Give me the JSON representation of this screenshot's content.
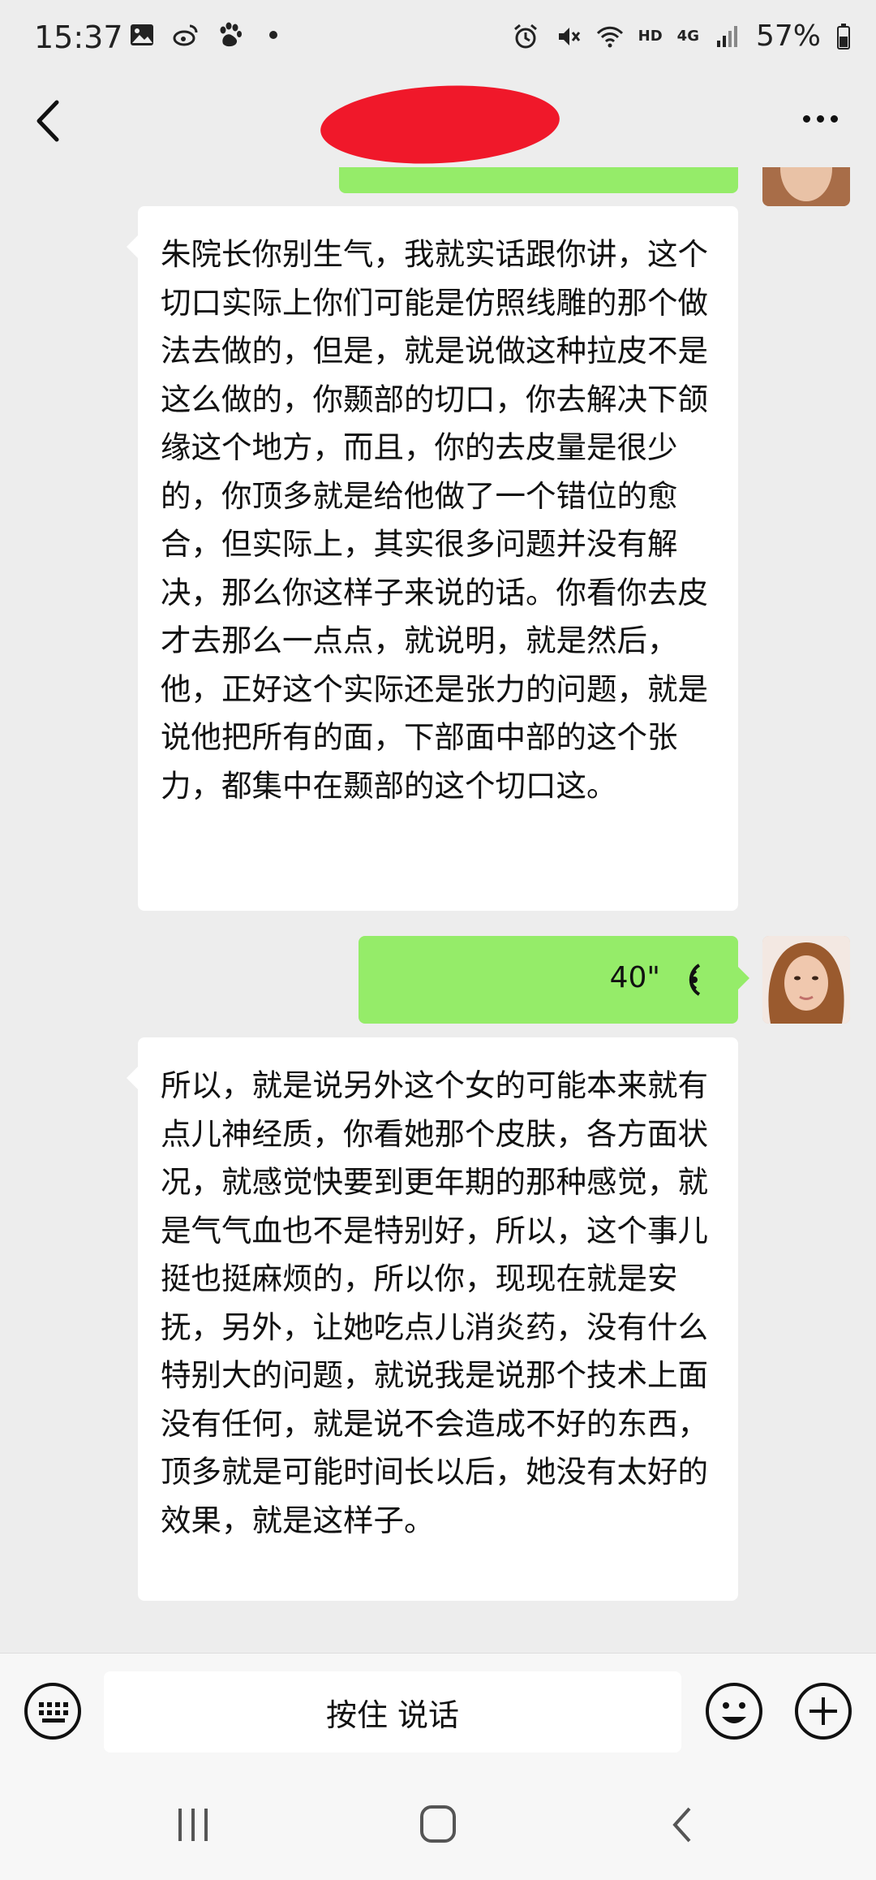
{
  "status_bar": {
    "time": "15:37",
    "network_hd": "HD",
    "network_4g": "4G",
    "battery": "57%"
  },
  "header": {
    "title_redacted": true
  },
  "messages": [
    {
      "side": "left",
      "type": "text",
      "text": "朱院长你别生气，我就实话跟你讲，这个切口实际上你们可能是仿照线雕的那个做法去做的，但是，就是说做这种拉皮不是这么做的，你颞部的切口，你去解决下颌缘这个地方，而且，你的去皮量是很少的，你顶多就是给他做了一个错位的愈合，但实际上，其实很多问题并没有解决，那么你这样子来说的话。你看你去皮才去那么一点点，就说明，就是然后，他，正好这个实际还是张力的问题，就是说他把所有的面，下部面中部的这个张力，都集中在颞部的这个切口这。"
    },
    {
      "side": "right",
      "type": "voice",
      "duration": "40\""
    },
    {
      "side": "left",
      "type": "text",
      "text": "所以，就是说另外这个女的可能本来就有点儿神经质，你看她那个皮肤，各方面状况，就感觉快要到更年期的那种感觉，就是气气血也不是特别好，所以，这个事儿挺也挺麻烦的，所以你，现现在就是安抚，另外，让她吃点儿消炎药，没有什么特别大的问题，就说我是说那个技术上面没有任何，就是说不会造成不好的东西，顶多就是可能时间长以后，她没有太好的效果，就是这样子。"
    }
  ],
  "input_bar": {
    "hold_to_talk": "按住 说话"
  },
  "colors": {
    "background": "#ededed",
    "sent_bubble": "#95ec69",
    "received_bubble": "#ffffff",
    "redaction": "#f0182a"
  }
}
